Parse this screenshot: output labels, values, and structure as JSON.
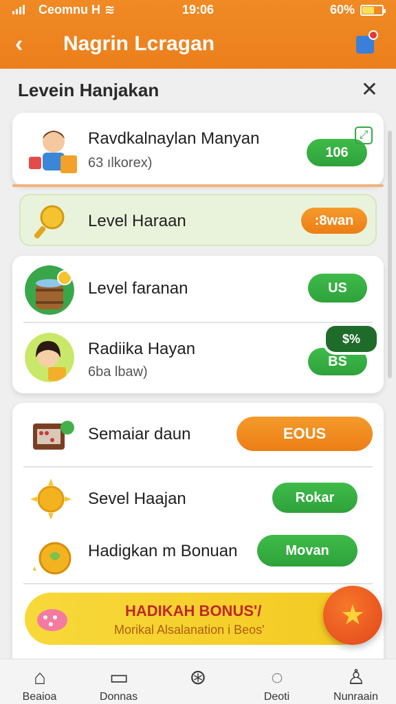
{
  "status_bar": {
    "carrier": "Ceomnu H",
    "time": "19:06",
    "battery": "60%"
  },
  "header": {
    "back_icon": "chevron-left-icon",
    "title": "Nagrin Lcragan",
    "profile_icon": "profile-badge-icon"
  },
  "sheet": {
    "title": "Levein Hanjakan",
    "close_icon": "close-icon"
  },
  "items": [
    {
      "title": "Ravdkalnaylan Manyan",
      "subtitle": "63 ılkorex)",
      "button": "106"
    },
    {
      "title": "Level Haraan",
      "button": ":8wan"
    },
    {
      "title": "Level faranan",
      "button": "US"
    },
    {
      "title": "Radiika Hayan",
      "subtitle": "6ba lbaw)",
      "button": "BS",
      "badge": "$%"
    },
    {
      "title": "Semaiar daun",
      "button": "EOUS"
    },
    {
      "title": "Sevel Haajan",
      "button": "Rokar"
    },
    {
      "title": "Hadigkan m Bonuan",
      "button": "Movan"
    }
  ],
  "banner": {
    "title": "HADIKAH BONUS'/",
    "subtitle": "Morikal Alsalanation i Beos'"
  },
  "tabs": [
    {
      "label": "Beaioa",
      "icon": "home-icon"
    },
    {
      "label": "Donnas",
      "icon": "bag-icon"
    },
    {
      "label": "",
      "icon": "compass-icon"
    },
    {
      "label": "Deoti",
      "icon": "chat-icon"
    },
    {
      "label": "Nunraain",
      "icon": "person-icon"
    }
  ],
  "colors": {
    "header": "#ec7f1c",
    "accent_green": "#35ad42",
    "accent_orange": "#ef8a1f",
    "banner": "#f5d030"
  }
}
